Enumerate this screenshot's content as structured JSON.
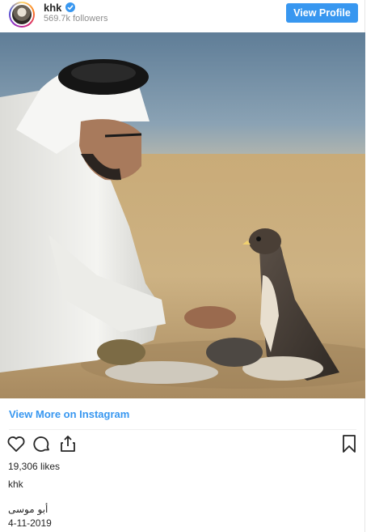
{
  "header": {
    "username": "khk",
    "verified": true,
    "followers": "569.7k followers",
    "view_profile_label": "View Profile"
  },
  "post": {
    "image_alt": "Man in white thobe and ghutra feeding a falcon in the desert",
    "view_more_label": "View More on Instagram",
    "likes": "19,306 likes",
    "caption_user": "khk",
    "caption_text": "أبو موسى",
    "date": "4-11-2019"
  },
  "colors": {
    "accent": "#3897f0",
    "text": "#262626",
    "muted": "#8e8e8e"
  },
  "icons": [
    "heart-icon",
    "comment-icon",
    "share-icon",
    "bookmark-icon",
    "verified-badge-icon"
  ]
}
